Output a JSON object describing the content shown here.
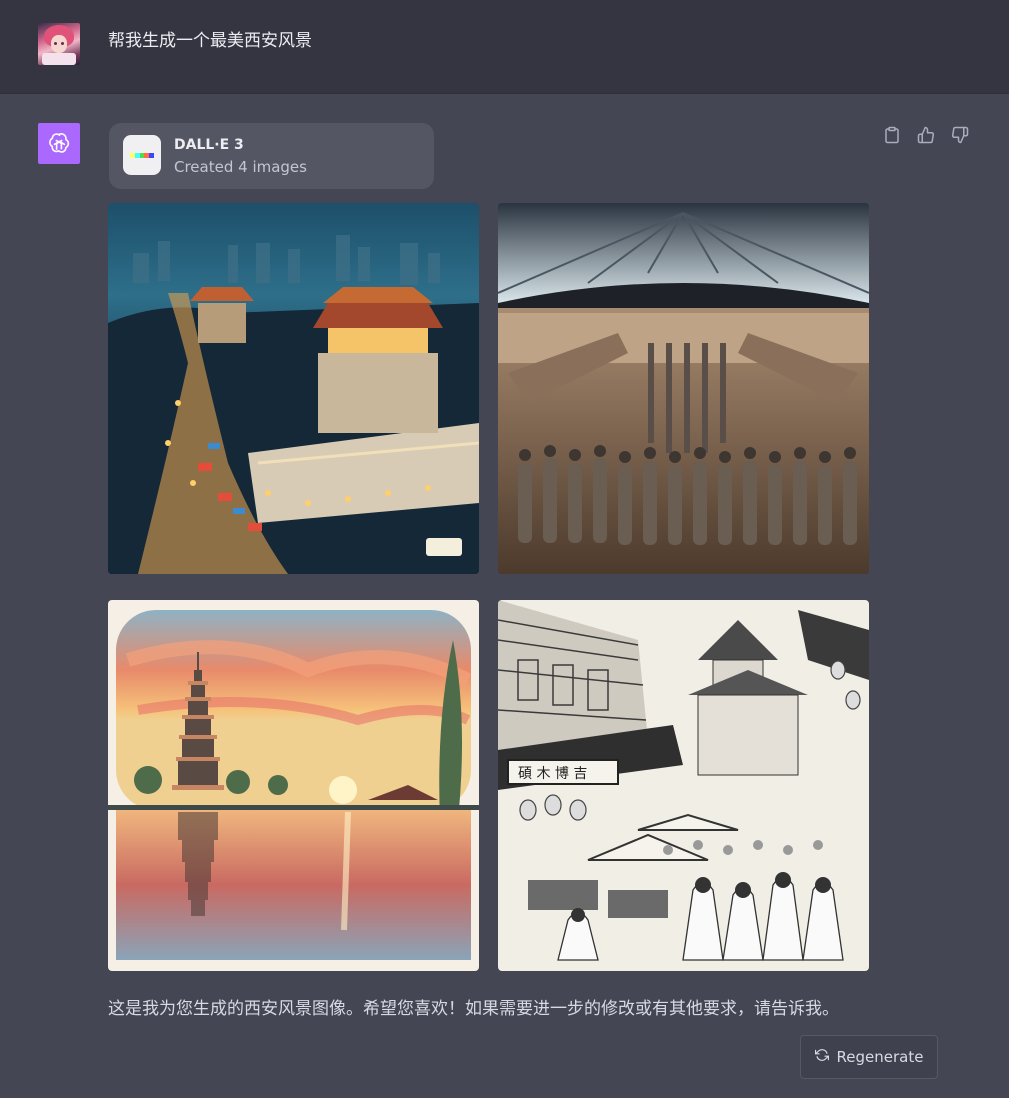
{
  "user": {
    "message": "帮我生成一个最美西安风景",
    "avatar_icon": "anime-avatar"
  },
  "assistant": {
    "avatar_icon": "openai-logo-icon",
    "avatar_color": "#ab68ff",
    "plugin": {
      "name": "DALL·E 3",
      "subtitle": "Created 4 images"
    },
    "actions": [
      {
        "icon": "clipboard-icon"
      },
      {
        "icon": "thumbs-up-icon"
      },
      {
        "icon": "thumbs-down-icon"
      }
    ],
    "images": [
      {
        "icon": "xian-city-wall-night-image"
      },
      {
        "icon": "terracotta-army-image"
      },
      {
        "icon": "big-wild-goose-pagoda-sunset-image"
      },
      {
        "icon": "xian-street-market-sketch-image"
      }
    ],
    "reply": "这是我为您生成的西安风景图像。希望您喜欢！如果需要进一步的修改或有其他要求，请告诉我。"
  },
  "regenerate": {
    "label": "Regenerate",
    "icon": "refresh-icon"
  },
  "colors": {
    "user_bg": "#343541",
    "assistant_bg": "#444654",
    "card_bg": "#555664"
  }
}
